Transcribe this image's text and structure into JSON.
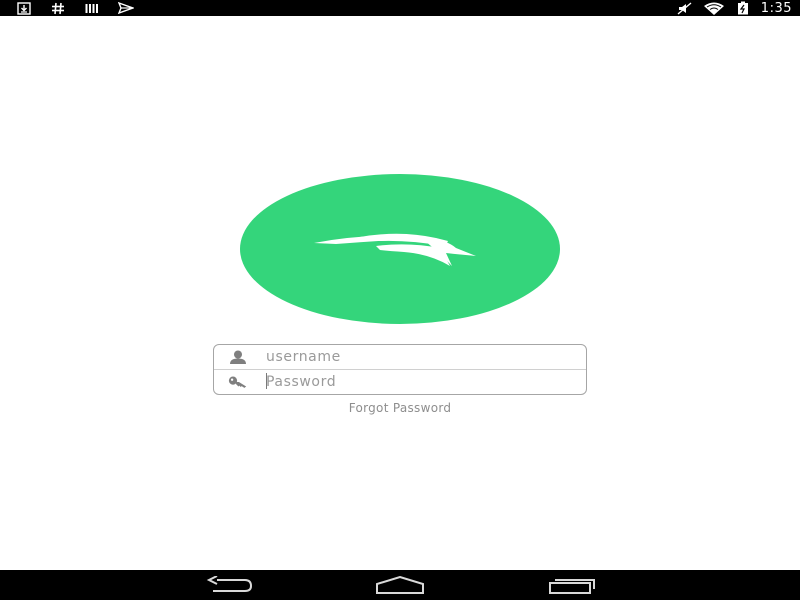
{
  "status_bar": {
    "time": "1:35",
    "left_icons": [
      "download-icon",
      "hash-icon",
      "signal-bars-icon",
      "send-icon"
    ],
    "right_icons": [
      "mute-icon",
      "wifi-icon",
      "battery-icon"
    ]
  },
  "logo": {
    "color": "#34d57b",
    "mark": "paper-wing-icon"
  },
  "login": {
    "username_placeholder": "username",
    "password_placeholder": "Password",
    "forgot_label": "Forgot Password"
  },
  "nav_bar": {
    "buttons": [
      "back-icon",
      "home-icon",
      "recents-icon"
    ]
  }
}
